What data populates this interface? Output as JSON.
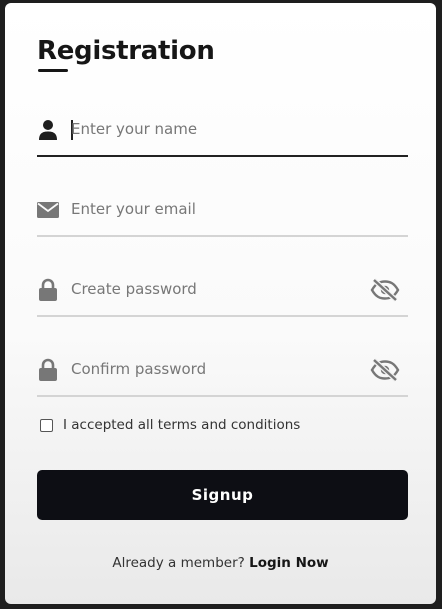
{
  "form": {
    "title": "Registration",
    "fields": [
      {
        "placeholder": "Enter your name",
        "value": "",
        "icon": "user-icon"
      },
      {
        "placeholder": "Enter your email",
        "value": "",
        "icon": "envelope-icon"
      },
      {
        "placeholder": "Create password",
        "value": "",
        "icon": "lock-icon",
        "toggle_icon": "eye-slash-icon"
      },
      {
        "placeholder": "Confirm password",
        "value": "",
        "icon": "lock-icon",
        "toggle_icon": "eye-slash-icon"
      }
    ],
    "terms_label": "I accepted all terms and conditions",
    "terms_checked": false,
    "submit_label": "Signup",
    "footer_text": "Already a member?",
    "footer_link": "Login Now"
  },
  "colors": {
    "button_bg": "#0d0e14",
    "icon_color": "#1e1e1e",
    "muted_icon_color": "#777777"
  }
}
